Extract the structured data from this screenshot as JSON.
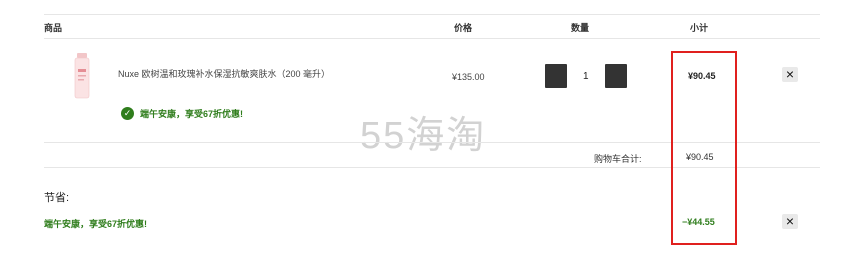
{
  "table": {
    "headers": {
      "product": "商品",
      "price": "价格",
      "quantity": "数量",
      "subtotal": "小计"
    }
  },
  "item": {
    "name": "Nuxe 欧树温和玫瑰补水保湿抗敏爽肤水（200 毫升）",
    "price": "¥135.00",
    "quantity": "1",
    "subtotal": "¥90.45",
    "remove_label": "×",
    "promo": "端午安康，享受67折优惠!"
  },
  "cart": {
    "total_label": "购物车合计:",
    "total_value": "¥90.45"
  },
  "savings": {
    "title": "节省:",
    "promo": "端午安康，享受67折优惠!",
    "amount": "−¥44.55",
    "remove_label": "×"
  },
  "watermark": "55海淘",
  "colors": {
    "promo_green": "#2f7d1c",
    "highlight_red": "#e0201e",
    "qty_button": "#333333"
  }
}
